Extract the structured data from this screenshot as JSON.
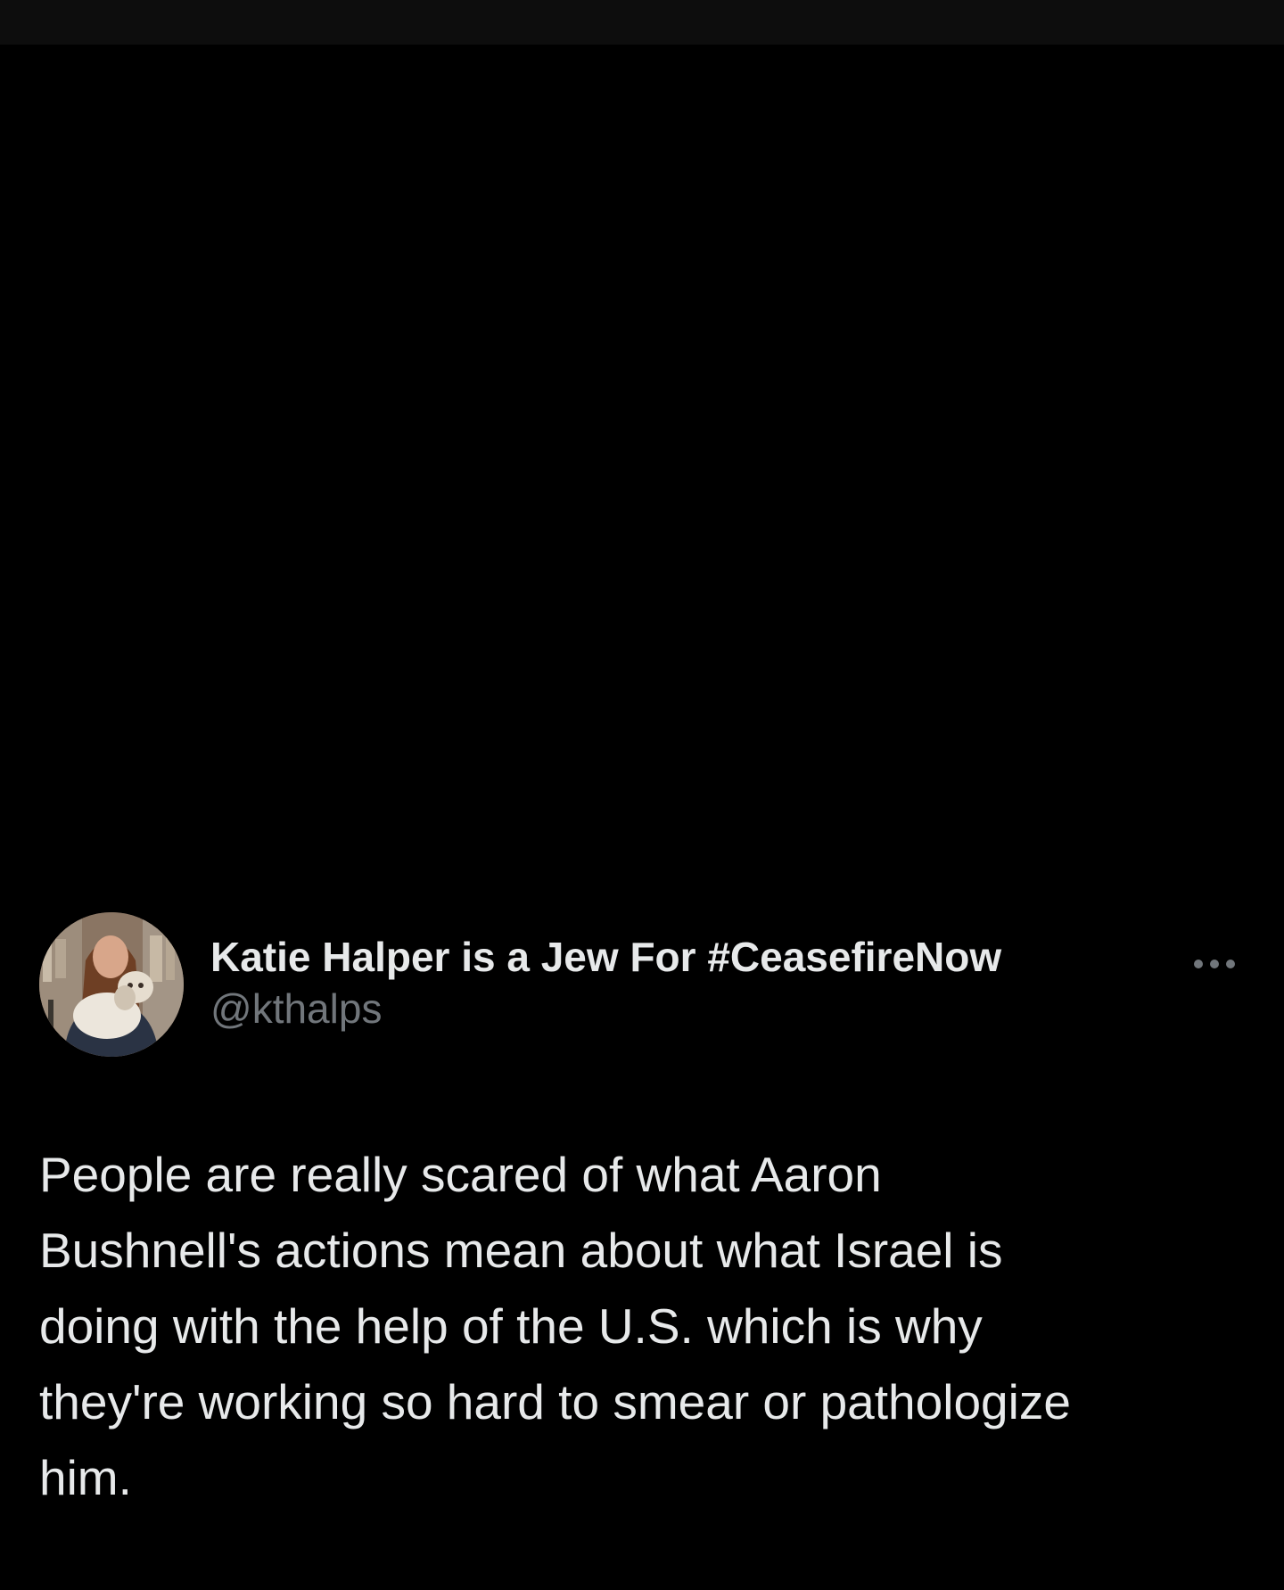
{
  "post": {
    "author": {
      "display_name": "Katie Halper is a Jew For #CeasefireNow",
      "handle": "@kthalps",
      "avatar_icon": "profile-photo"
    },
    "more_icon": "more-options-icon",
    "text": "People are really scared of what Aaron\nBushnell's actions mean about what Israel is\ndoing with the help of the U.S. which is why\nthey're working so hard to smear or pathologize\nhim."
  },
  "colors": {
    "background": "#000000",
    "primary_text": "#e7e9ea",
    "secondary_text": "#71767b"
  }
}
